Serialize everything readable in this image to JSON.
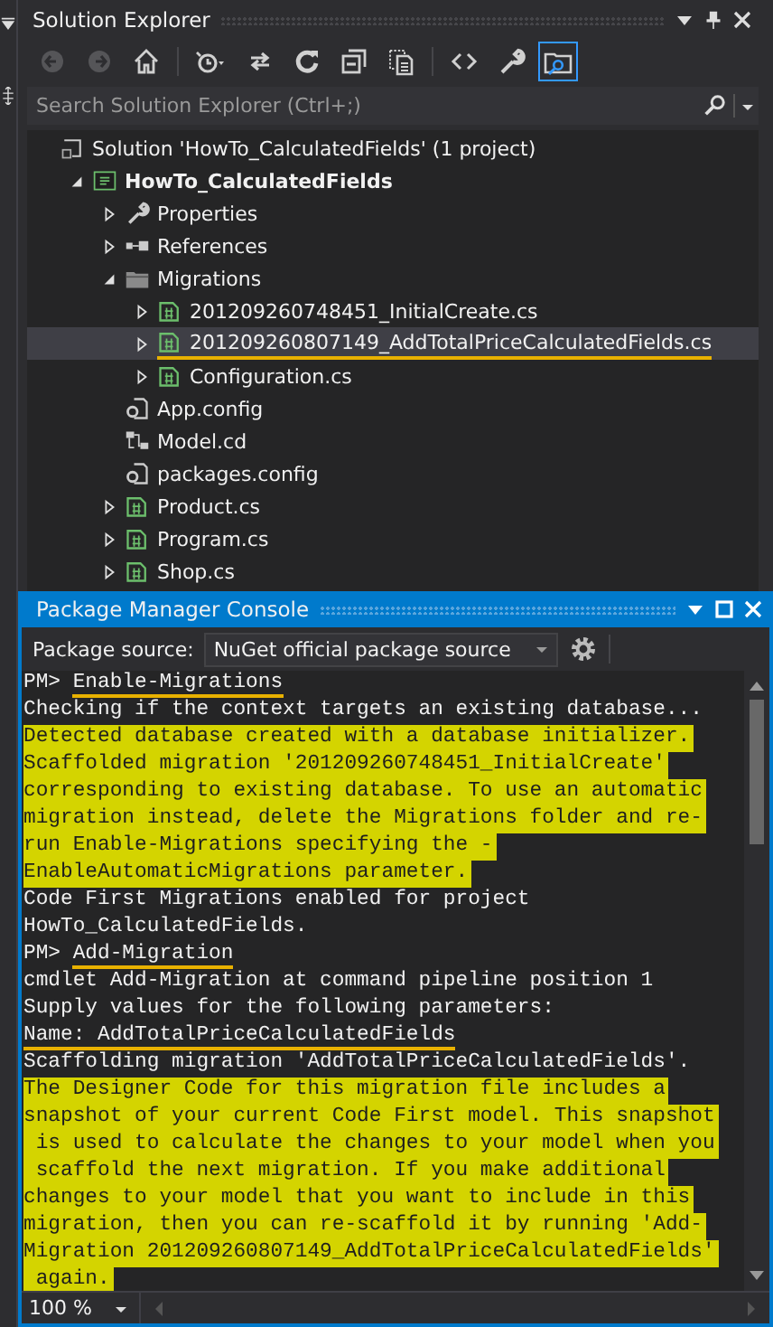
{
  "solution_explorer": {
    "title": "Solution Explorer",
    "toolbar": [
      {
        "kind": "back",
        "disabled": true,
        "on": false
      },
      {
        "kind": "forward",
        "disabled": true,
        "on": false
      },
      {
        "kind": "home",
        "disabled": false,
        "on": false
      },
      {
        "kind": "history",
        "disabled": false,
        "on": false
      },
      {
        "kind": "sync",
        "disabled": false,
        "on": false
      },
      {
        "kind": "refresh",
        "disabled": false,
        "on": false
      },
      {
        "kind": "collapse",
        "disabled": false,
        "on": false
      },
      {
        "kind": "files",
        "disabled": false,
        "on": false
      },
      {
        "kind": "code",
        "disabled": false,
        "on": false
      },
      {
        "kind": "properties",
        "disabled": false,
        "on": false
      },
      {
        "kind": "preview",
        "disabled": false,
        "on": true
      }
    ],
    "search": {
      "placeholder": "Search Solution Explorer (Ctrl+;)"
    },
    "tree": [
      {
        "label": "Solution 'HowTo_CalculatedFields' (1 project)",
        "kind": "solution",
        "selected": false,
        "underlined": false,
        "children": [
          {
            "label": "HowTo_CalculatedFields",
            "kind": "project",
            "expanded": true,
            "selected": false,
            "underlined": false,
            "children": [
              {
                "label": "Properties",
                "kind": "properties",
                "expanded": false,
                "selected": false,
                "underlined": false
              },
              {
                "label": "References",
                "kind": "references",
                "expanded": false,
                "selected": false,
                "underlined": false
              },
              {
                "label": "Migrations",
                "kind": "folder",
                "expanded": true,
                "selected": false,
                "underlined": false,
                "children": [
                  {
                    "label": "201209260748451_InitialCreate.cs",
                    "kind": "code",
                    "expanded": false,
                    "selected": false,
                    "underlined": false
                  },
                  {
                    "label": "201209260807149_AddTotalPriceCalculatedFields.cs",
                    "kind": "code",
                    "expanded": false,
                    "selected": true,
                    "underlined": true
                  },
                  {
                    "label": "Configuration.cs",
                    "kind": "code",
                    "expanded": false,
                    "selected": false,
                    "underlined": false
                  }
                ]
              },
              {
                "label": "App.config",
                "kind": "config",
                "selected": false,
                "underlined": false
              },
              {
                "label": "Model.cd",
                "kind": "diagram",
                "selected": false,
                "underlined": false
              },
              {
                "label": "packages.config",
                "kind": "config",
                "selected": false,
                "underlined": false
              },
              {
                "label": "Product.cs",
                "kind": "code",
                "expanded": false,
                "selected": false,
                "underlined": false
              },
              {
                "label": "Program.cs",
                "kind": "code",
                "expanded": false,
                "selected": false,
                "underlined": false
              },
              {
                "label": "Shop.cs",
                "kind": "code",
                "expanded": false,
                "selected": false,
                "underlined": false
              }
            ]
          }
        ]
      }
    ]
  },
  "console": {
    "title": "Package Manager Console",
    "source_label": "Package source:",
    "source": "NuGet official package source",
    "lines": [
      {
        "prompt": "PM>",
        "text": "Enable-Migrations",
        "highlighted": false,
        "underlined": true
      },
      {
        "text": "Checking if the context targets an existing database...",
        "highlighted": false,
        "underlined": false
      },
      {
        "text": "Detected database created with a database initializer.",
        "highlighted": true,
        "underlined": false
      },
      {
        "text": "Scaffolded migration '201209260748451_InitialCreate'",
        "highlighted": true,
        "underlined": false
      },
      {
        "text": "corresponding to existing database. To use an automatic",
        "highlighted": true,
        "underlined": false
      },
      {
        "text": "migration instead, delete the Migrations folder and re-",
        "highlighted": true,
        "underlined": false
      },
      {
        "text": "run Enable-Migrations specifying the -",
        "highlighted": true,
        "underlined": false
      },
      {
        "text": "EnableAutomaticMigrations parameter.",
        "highlighted": true,
        "underlined": false
      },
      {
        "text": "Code First Migrations enabled for project",
        "highlighted": false,
        "underlined": false
      },
      {
        "text": "HowTo_CalculatedFields.",
        "highlighted": false,
        "underlined": false
      },
      {
        "prompt": "PM>",
        "text": "Add-Migration",
        "highlighted": false,
        "underlined": true
      },
      {
        "text": "cmdlet Add-Migration at command pipeline position 1",
        "highlighted": false,
        "underlined": false
      },
      {
        "text": "Supply values for the following parameters:",
        "highlighted": false,
        "underlined": false
      },
      {
        "text": "Name: AddTotalPriceCalculatedFields",
        "highlighted": false,
        "underlined": true
      },
      {
        "text": "Scaffolding migration 'AddTotalPriceCalculatedFields'.",
        "highlighted": false,
        "underlined": false
      },
      {
        "text": "The Designer Code for this migration file includes a",
        "highlighted": true,
        "underlined": false
      },
      {
        "text": "snapshot of your current Code First model. This snapshot",
        "highlighted": true,
        "underlined": false
      },
      {
        "text": " is used to calculate the changes to your model when you",
        "highlighted": true,
        "underlined": false
      },
      {
        "text": " scaffold the next migration. If you make additional",
        "highlighted": true,
        "underlined": false
      },
      {
        "text": "changes to your model that you want to include in this",
        "highlighted": true,
        "underlined": false
      },
      {
        "text": "migration, then you can re-scaffold it by running 'Add-",
        "highlighted": true,
        "underlined": false
      },
      {
        "text": "Migration 201209260807149_AddTotalPriceCalculatedFields'",
        "highlighted": true,
        "underlined": false
      },
      {
        "text": " again.",
        "highlighted": true,
        "underlined": false
      }
    ],
    "zoom": "100 %"
  }
}
